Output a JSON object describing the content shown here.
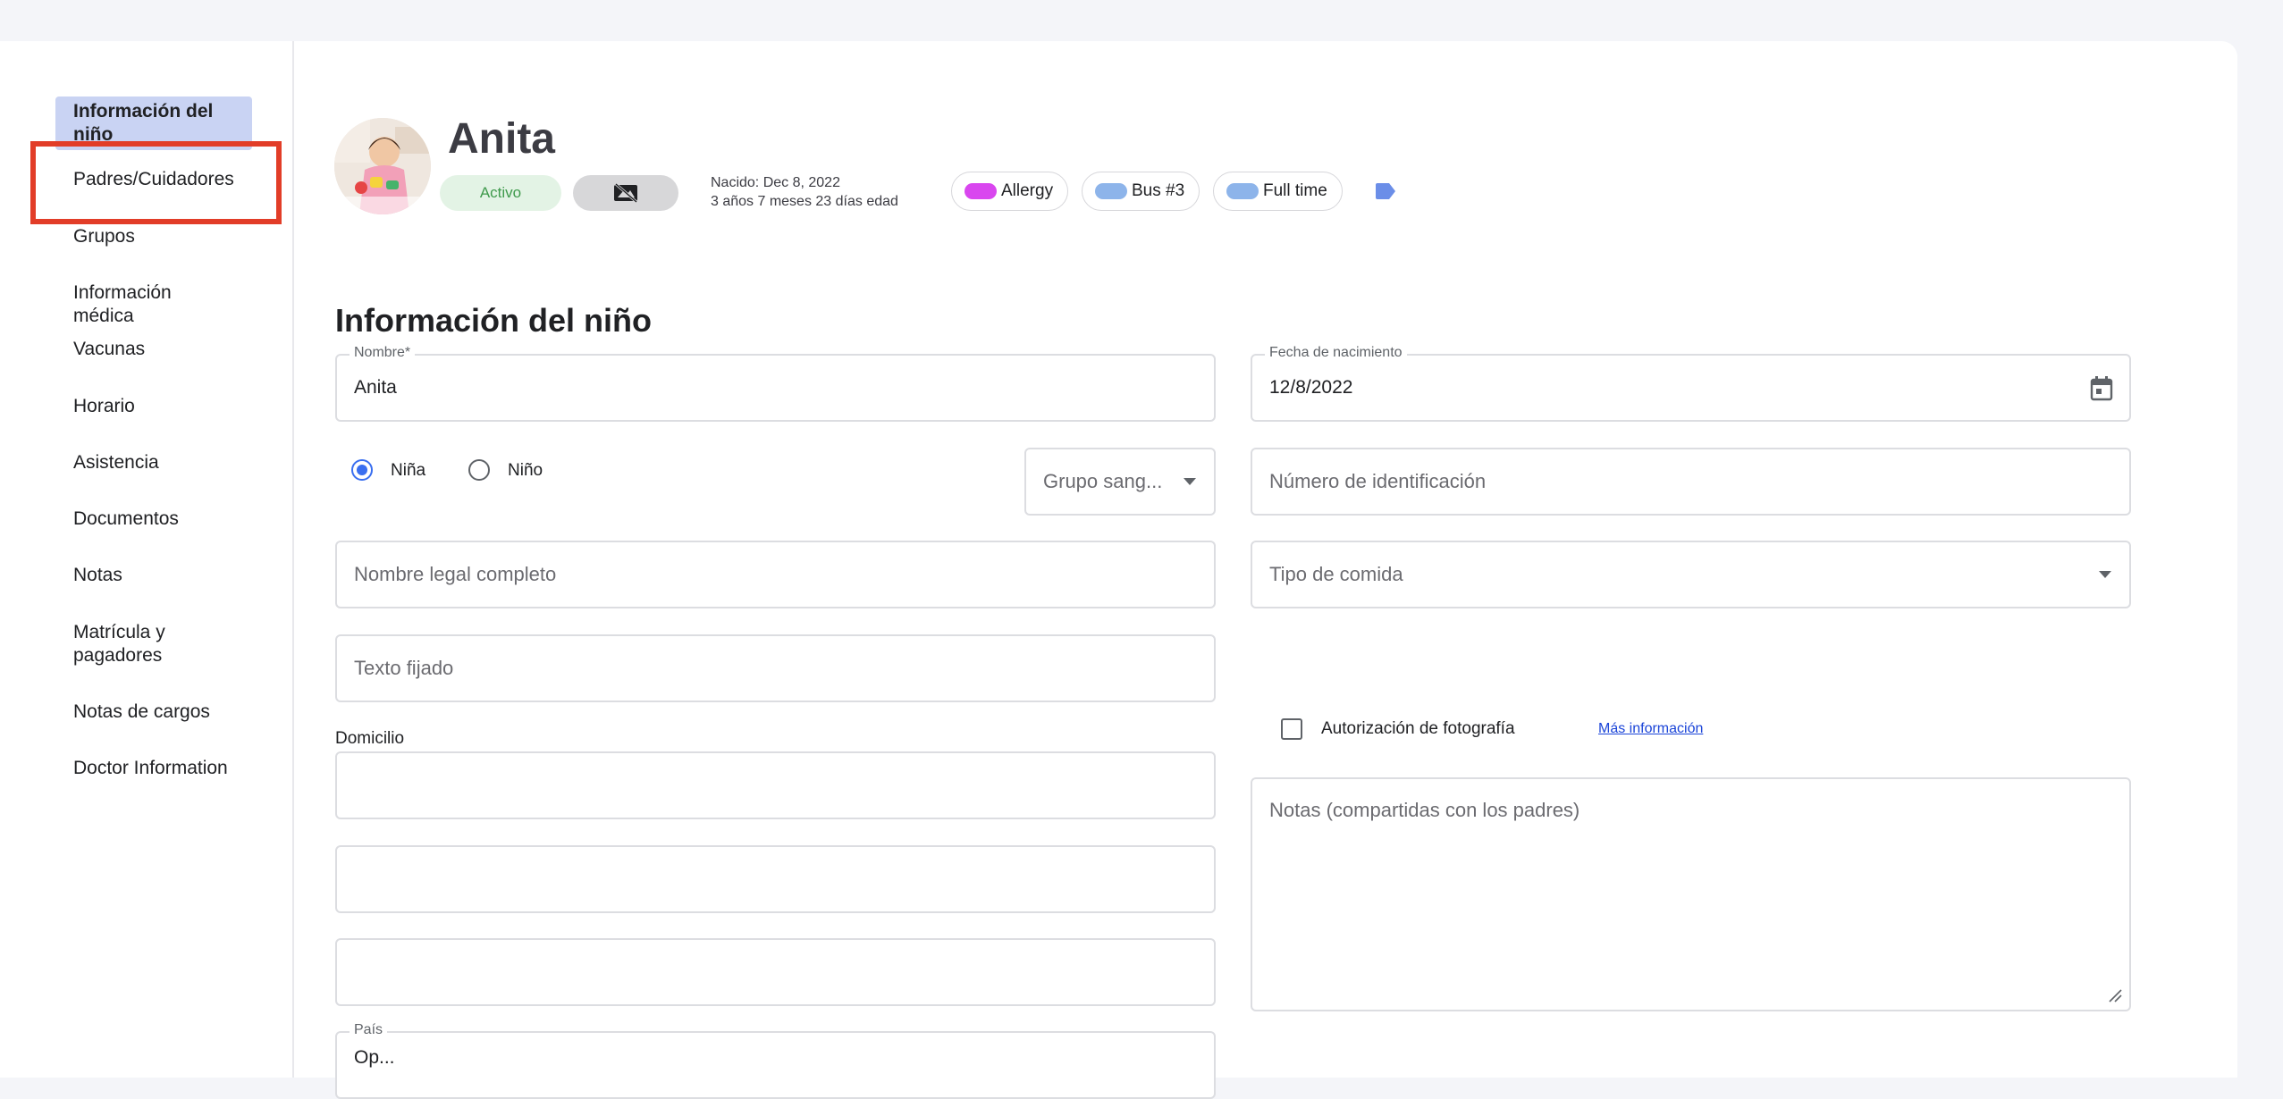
{
  "sidebar": {
    "items": [
      {
        "label": "Información del niño"
      },
      {
        "label": "Padres/Cuidadores"
      },
      {
        "label": "Grupos"
      },
      {
        "label": "Información médica"
      },
      {
        "label": "Vacunas"
      },
      {
        "label": "Horario"
      },
      {
        "label": "Asistencia"
      },
      {
        "label": "Documentos"
      },
      {
        "label": "Notas"
      },
      {
        "label": "Matrícula y pagadores"
      },
      {
        "label": "Notas de cargos"
      },
      {
        "label": "Doctor Information"
      }
    ]
  },
  "profile": {
    "name": "Anita",
    "status": "Activo",
    "born_line": "Nacido: Dec 8, 2022",
    "age_line": "3 años 7 meses 23 días edad",
    "tags": [
      {
        "label": "Allergy",
        "color": "#d946ef"
      },
      {
        "label": "Bus #3",
        "color": "#8db4ea"
      },
      {
        "label": "Full time",
        "color": "#8db4ea"
      }
    ],
    "tag_add_color": "#6b8ee8"
  },
  "section_title": "Información del niño",
  "form": {
    "name_label": "Nombre*",
    "name_value": "Anita",
    "birth_label": "Fecha de nacimiento",
    "birth_value": "12/8/2022",
    "gender_female": "Niña",
    "gender_male": "Niño",
    "blood_placeholder": "Grupo sang...",
    "id_placeholder": "Número de identificación",
    "legal_name_placeholder": "Nombre legal completo",
    "food_placeholder": "Tipo de comida",
    "pinned_placeholder": "Texto fijado",
    "photo_consent_label": "Autorización de fotografía",
    "more_info_link": "Más información",
    "address_label": "Domicilio",
    "notes_placeholder": "Notas (compartidas con los padres)",
    "country_label": "País",
    "country_value": "Op..."
  },
  "colors": {
    "accent": "#3a6ff0",
    "active_sidebar": "#c9d3f3",
    "highlight_box": "#e23d28",
    "status_green": "#3f9a4c"
  }
}
